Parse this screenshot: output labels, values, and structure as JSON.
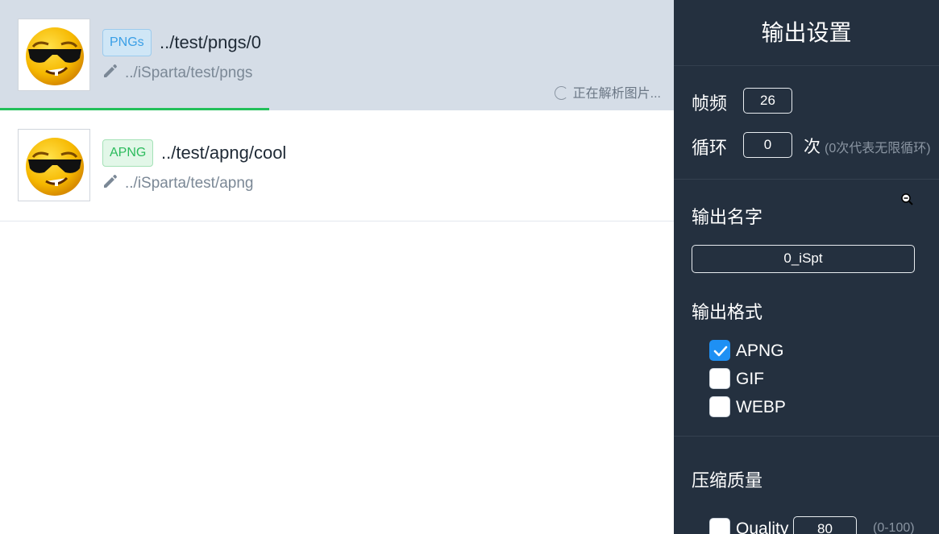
{
  "list": {
    "items": [
      {
        "badge": "PNGs",
        "path": "../test/pngs/0",
        "output_path": "../iSparta/test/pngs",
        "status": "正在解析图片...",
        "progress": 0.4,
        "selected": true
      },
      {
        "badge": "APNG",
        "path": "../test/apng/cool",
        "output_path": "../iSparta/test/apng",
        "selected": false
      }
    ]
  },
  "panel": {
    "title": "输出设置",
    "frame_rate": {
      "label": "帧频",
      "value": "26"
    },
    "loop": {
      "label": "循环",
      "value": "0",
      "unit": "次",
      "hint": "(0次代表无限循环)"
    },
    "output_name": {
      "label": "输出名字",
      "value": "0_iSpt"
    },
    "output_format": {
      "label": "输出格式",
      "options": [
        {
          "label": "APNG",
          "checked": true
        },
        {
          "label": "GIF",
          "checked": false
        },
        {
          "label": "WEBP",
          "checked": false
        }
      ]
    },
    "compression": {
      "label": "压缩质量",
      "quality_label": "Quality",
      "quality_value": "80",
      "quality_range": "(0-100)",
      "checked": false
    }
  },
  "colors": {
    "panel_bg": "#24303f",
    "selected_row_bg": "#d5dde7",
    "progress": "#23c05a",
    "pngs_badge": "#3a9fe6",
    "apng_badge": "#2bbb5c",
    "checkbox_checked": "#1e90f4"
  }
}
